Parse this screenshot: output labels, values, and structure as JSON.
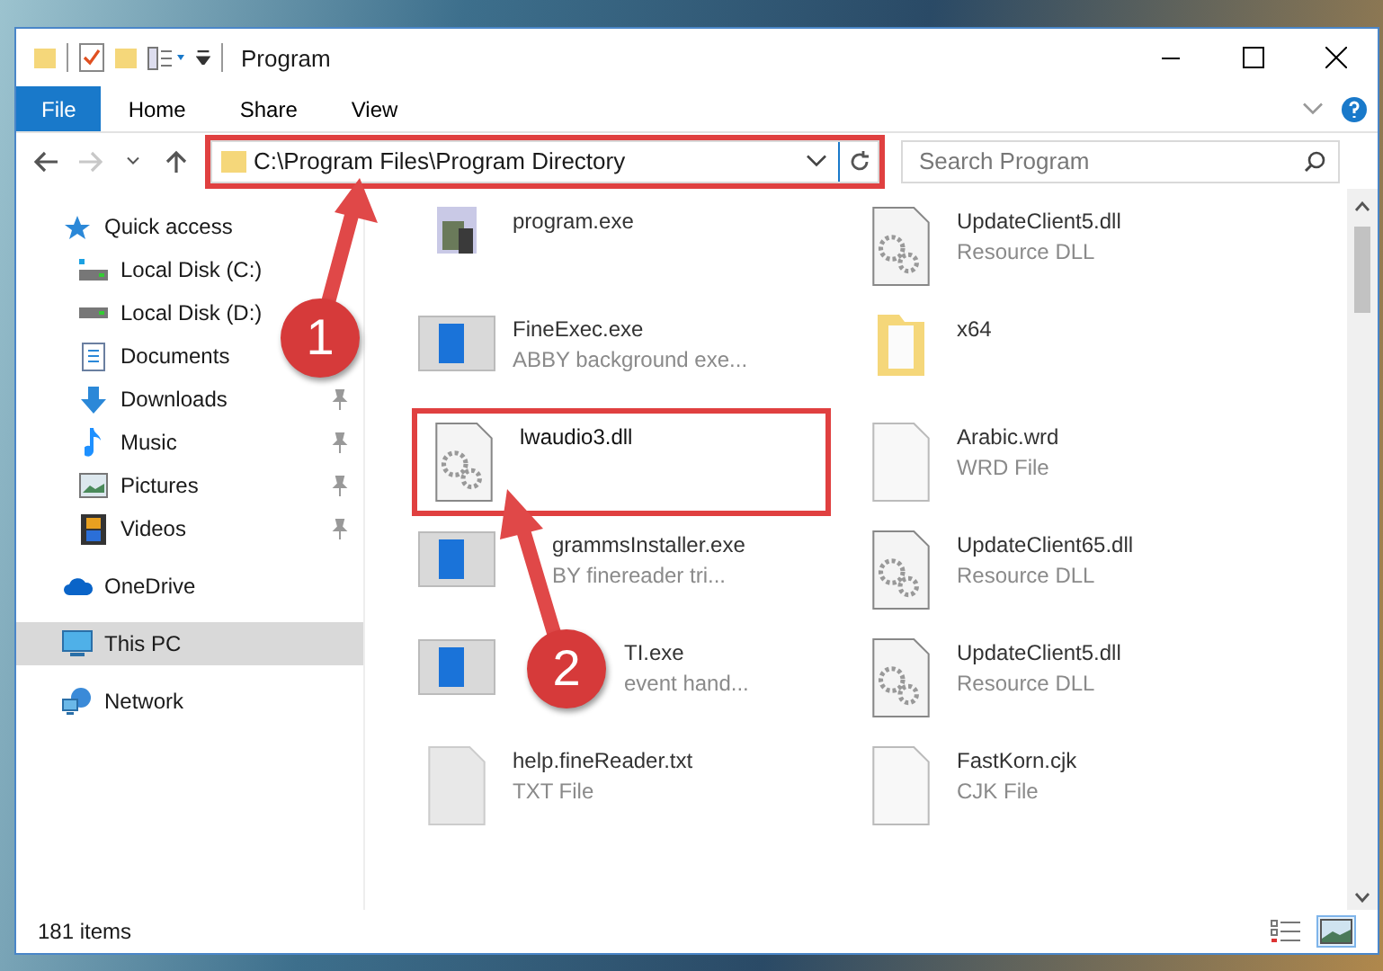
{
  "window": {
    "title": "Program"
  },
  "ribbon": {
    "tabs": [
      {
        "label": "File",
        "kind": "file"
      },
      {
        "label": "Home",
        "kind": "tab"
      },
      {
        "label": "Share",
        "kind": "tab"
      },
      {
        "label": "View",
        "kind": "tab"
      }
    ]
  },
  "navigation": {
    "back": {
      "disabled": false
    },
    "forward": {
      "disabled": true
    }
  },
  "address_bar": {
    "path": "C:\\Program Files\\Program Directory",
    "highlighted": true
  },
  "search": {
    "placeholder": "Search Program"
  },
  "sidebar": {
    "items": [
      {
        "label": "Quick access",
        "kind": "star",
        "selected": false,
        "children": [
          {
            "label": "Local Disk (C:)",
            "kind": "drive-c",
            "selected": false
          },
          {
            "label": "Local Disk (D:)",
            "kind": "drive",
            "selected": false
          },
          {
            "label": "Documents",
            "kind": "documents",
            "selected": false
          },
          {
            "label": "Downloads",
            "kind": "downloads",
            "pinned": true,
            "selected": false
          },
          {
            "label": "Music",
            "kind": "music",
            "pinned": true,
            "selected": false
          },
          {
            "label": "Pictures",
            "kind": "pictures",
            "pinned": true,
            "selected": false
          },
          {
            "label": "Videos",
            "kind": "videos",
            "pinned": true,
            "selected": false
          }
        ]
      },
      {
        "label": "OneDrive",
        "kind": "onedrive",
        "selected": false
      },
      {
        "label": "This PC",
        "kind": "pc",
        "selected": true
      },
      {
        "label": "Network",
        "kind": "network",
        "selected": false
      }
    ]
  },
  "files": [
    {
      "name": "program.exe",
      "kind": "installer",
      "highlighted": false
    },
    {
      "name": "UpdateClient5.dll",
      "description": "Resource DLL",
      "kind": "dll",
      "highlighted": false
    },
    {
      "name": "FineExec.exe",
      "description": "ABBY background exe...",
      "kind": "app",
      "highlighted": false
    },
    {
      "name": "x64",
      "kind": "folder",
      "highlighted": false
    },
    {
      "name": "lwaudio3.dll",
      "kind": "dll",
      "highlighted": true
    },
    {
      "name": "Arabic.wrd",
      "description": "WRD File",
      "kind": "file",
      "highlighted": false
    },
    {
      "name": "grammsInstaller.exe",
      "description": "BY finereader tri...",
      "kind": "app",
      "highlighted": false
    },
    {
      "name": "UpdateClient65.dll",
      "description": "Resource DLL",
      "kind": "dll",
      "highlighted": false
    },
    {
      "name": "TI.exe",
      "description": "event hand...",
      "kind": "app",
      "highlighted": false
    },
    {
      "name": "UpdateClient5.dll",
      "description": "Resource DLL",
      "kind": "dll",
      "highlighted": false
    },
    {
      "name": "help.fineReader.txt",
      "description": "TXT File",
      "kind": "text",
      "highlighted": false
    },
    {
      "name": "FastKorn.cjk",
      "description": "CJK File",
      "kind": "file",
      "highlighted": false
    }
  ],
  "status_bar": {
    "count": "181 items",
    "views": [
      {
        "kind": "details",
        "selected": false
      },
      {
        "kind": "large-icons",
        "selected": true
      }
    ]
  },
  "callouts": [
    {
      "number": "1"
    },
    {
      "number": "2"
    }
  ]
}
